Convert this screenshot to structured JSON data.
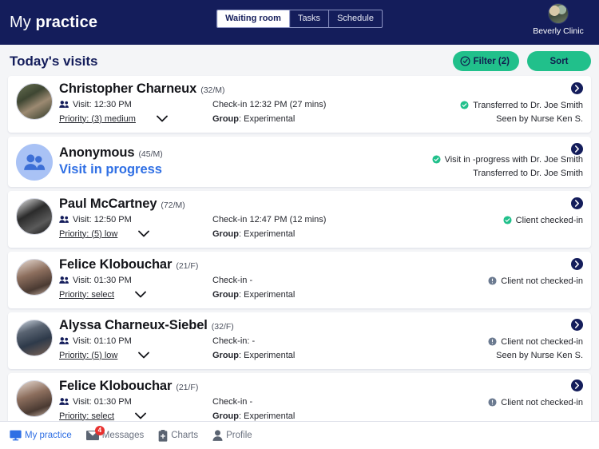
{
  "header": {
    "brand_light": "My ",
    "brand_bold": "practice",
    "tabs": [
      {
        "label": "Waiting room",
        "active": true
      },
      {
        "label": "Tasks",
        "active": false
      },
      {
        "label": "Schedule",
        "active": false
      }
    ],
    "clinic_name": "Beverly Clinic",
    "clinic_avatar_icon": "clinic-photo-avatar"
  },
  "section": {
    "title": "Today's visits",
    "filter_label": "Filter (2)",
    "filter_icon": "check-circle-icon",
    "sort_label": "Sort"
  },
  "colors": {
    "navy": "#141d5b",
    "green": "#21c08b",
    "blue": "#2f6fe4",
    "status_green": "#21c08b",
    "status_grey": "#6b7a90",
    "badge_red": "#e8312f"
  },
  "labels": {
    "visit_prefix": "Visit: ",
    "priority_prefix": "Priority: ",
    "group_prefix": "Group",
    "group_sep": ": "
  },
  "visits": [
    {
      "type": "standard",
      "avatar": "av1",
      "name": "Christopher Charneux",
      "age_sex": "(32/M)",
      "visit": "Visit: 12:30 PM",
      "priority": "Priority: (3) medium",
      "checkin": "Check-in 12:32 PM (27 mins)",
      "group_label": "Group",
      "group_value": ": Experimental",
      "status_icon": "check-circle-green-icon",
      "status_primary": "Transferred to Dr. Joe Smith",
      "status_secondary": "Seen by Nurse Ken S."
    },
    {
      "type": "anonymous",
      "avatar": "av-anon",
      "avatar_icon": "people-avatar-icon",
      "name": "Anonymous",
      "age_sex": "(45/M)",
      "progress_label": "Visit in progress",
      "status_icon": "check-circle-green-icon",
      "status_primary": "Visit in -progress with Dr. Joe Smith",
      "status_secondary": "Transferred to Dr. Joe Smith"
    },
    {
      "type": "standard",
      "avatar": "av2",
      "name": "Paul McCartney",
      "age_sex": "(72/M)",
      "visit": "Visit: 12:50 PM",
      "priority": "Priority: (5) low",
      "checkin": "Check-in 12:47 PM (12 mins)",
      "group_label": "Group",
      "group_value": ": Experimental",
      "status_icon": "check-circle-green-icon",
      "status_primary": "Client checked-in",
      "status_secondary": ""
    },
    {
      "type": "standard",
      "avatar": "av3",
      "name": "Felice Klobouchar",
      "age_sex": "(21/F)",
      "visit": "Visit: 01:30 PM",
      "priority": "Priority: select",
      "checkin": "Check-in -",
      "group_label": "Group",
      "group_value": ": Experimental",
      "status_icon": "info-circle-grey-icon",
      "status_primary": "Client not checked-in",
      "status_secondary": ""
    },
    {
      "type": "standard",
      "avatar": "av4",
      "name": "Alyssa Charneux-Siebel",
      "age_sex": "(32/F)",
      "visit": "Visit: 01:10 PM",
      "priority": "Priority: (5) low",
      "checkin": "Check-in: -",
      "group_label": "Group",
      "group_value": ": Experimental",
      "status_icon": "info-circle-grey-icon",
      "status_primary": "Client not checked-in",
      "status_secondary": "Seen by Nurse Ken S."
    },
    {
      "type": "standard",
      "avatar": "av5",
      "name": "Felice Klobouchar",
      "age_sex": "(21/F)",
      "visit": "Visit: 01:30 PM",
      "priority": "Priority: select",
      "checkin": "Check-in -",
      "group_label": "Group",
      "group_value": ": Experimental",
      "status_icon": "info-circle-grey-icon",
      "status_primary": "Client not checked-in",
      "status_secondary": ""
    }
  ],
  "bottom_nav": [
    {
      "label": "My practice",
      "icon": "monitor-icon",
      "active": true,
      "badge": ""
    },
    {
      "label": "Messages",
      "icon": "envelope-icon",
      "active": false,
      "badge": "4"
    },
    {
      "label": "Charts",
      "icon": "clipboard-icon",
      "active": false,
      "badge": ""
    },
    {
      "label": "Profile",
      "icon": "person-icon",
      "active": false,
      "badge": ""
    }
  ]
}
